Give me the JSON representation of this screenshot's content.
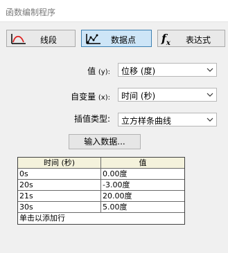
{
  "window": {
    "title": "函数编制程序"
  },
  "modes": [
    {
      "label": "线段",
      "icon": "segment-curve-icon",
      "active": false
    },
    {
      "label": "数据点",
      "icon": "data-points-icon",
      "active": true
    },
    {
      "label": "表达式",
      "icon": "fx-icon",
      "active": false
    }
  ],
  "fx_text": {
    "f": "f",
    "x": "x"
  },
  "value_field": {
    "label": "值",
    "hint": "(y):",
    "selected": "位移 (度)"
  },
  "variable_field": {
    "label": "自变量",
    "hint": "(x):",
    "selected": "时间 (秒)"
  },
  "interp_field": {
    "label": "插值类型:",
    "selected": "立方样条曲线"
  },
  "input_button": {
    "label": "输入数据..."
  },
  "table": {
    "headers": [
      "时间 (秒)",
      "值"
    ],
    "rows": [
      [
        "0s",
        "0.00度"
      ],
      [
        "20s",
        "-3.00度"
      ],
      [
        "21s",
        "20.00度"
      ],
      [
        "30s",
        "5.00度"
      ]
    ],
    "add_row_text": "单击以添加行"
  },
  "colors": {
    "active_mode_bg": "#cde5f7",
    "active_mode_border": "#3c7fb1",
    "header_bg": "#f4f2dc"
  }
}
